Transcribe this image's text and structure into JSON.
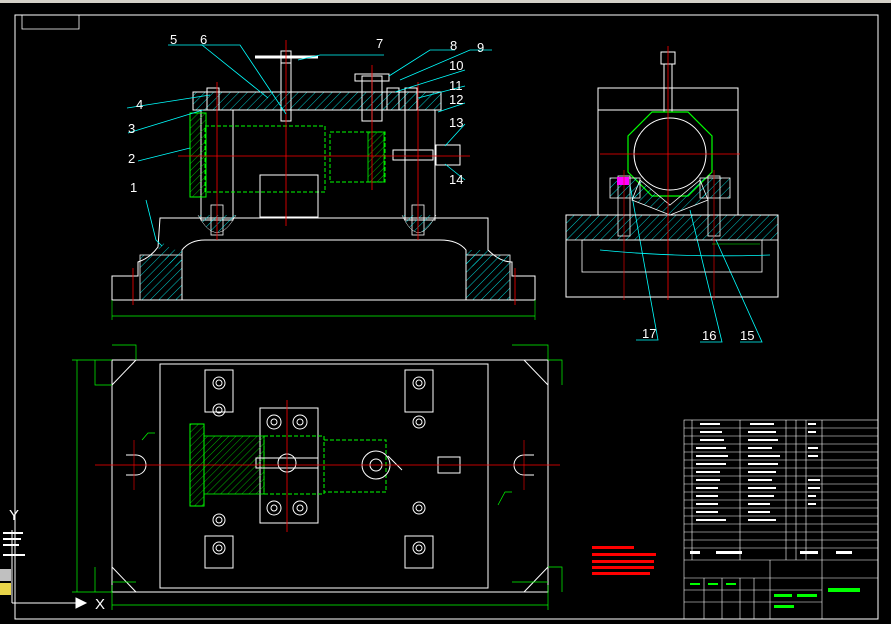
{
  "axes": {
    "x_label": "X",
    "y_label": "Y"
  },
  "part_numbers": [
    "1",
    "2",
    "3",
    "4",
    "5",
    "6",
    "7",
    "8",
    "9",
    "10",
    "11",
    "12",
    "13",
    "14",
    "15",
    "16",
    "17"
  ],
  "icons": [
    "layer-tool-icon",
    "snap-tool-icon",
    "ucs-icon"
  ],
  "colors": {
    "background": "#000000",
    "outline": "#ffffff",
    "centerline": "#ff0000",
    "hatch": "#00ffff",
    "leader": "#00ffff",
    "hidden": "#00ff00",
    "accent": "#ffff00",
    "note": "#ff0000"
  }
}
